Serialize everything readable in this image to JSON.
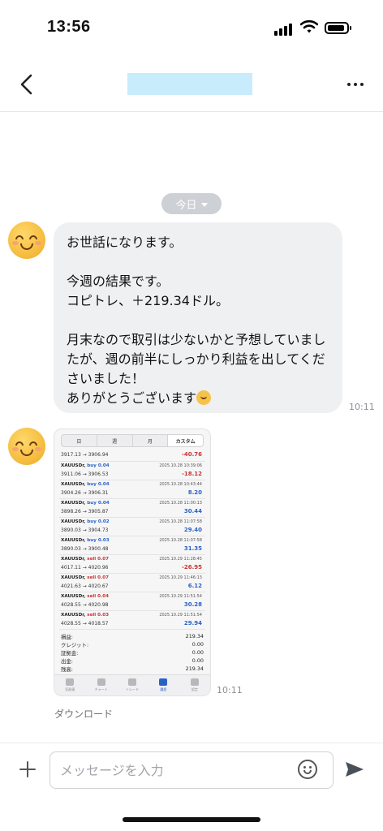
{
  "status_bar": {
    "time": "13:56"
  },
  "header": {
    "title_redacted": true,
    "title_block_color": "#c8ecfb"
  },
  "chat": {
    "date_chip": "今日",
    "text_message": {
      "lines": [
        "お世話になります。",
        "",
        "今週の結果です。",
        "コピトレ、＋219.34ドル。",
        "",
        "月末なので取引は少ないかと予想していましたが、週の前半にしっかり利益を出してくださいました！",
        "ありがとうございます"
      ],
      "time": "10:11"
    },
    "image_message": {
      "time": "10:11",
      "download_label": "ダウンロード",
      "tabs": [
        "日",
        "週",
        "月",
        "カスタム"
      ],
      "active_tab": "カスタム",
      "first_row": {
        "prices": "3917.13 → 3906.94",
        "pl": "-40.76",
        "pl_type": "neg"
      },
      "trades": [
        {
          "symbol": "XAUUSDr,",
          "side": "buy",
          "lot": "0.04",
          "prices": "3911.06 → 3906.53",
          "datetime": "2025.10.28 10:39:06",
          "pl": "-18.12",
          "pl_type": "neg"
        },
        {
          "symbol": "XAUUSDr,",
          "side": "buy",
          "lot": "0.04",
          "prices": "3904.26 → 3906.31",
          "datetime": "2025.10.28 10:43:44",
          "pl": "8.20",
          "pl_type": "pos"
        },
        {
          "symbol": "XAUUSDr,",
          "side": "buy",
          "lot": "0.04",
          "prices": "3898.26 → 3905.87",
          "datetime": "2025.10.28 11:00:13",
          "pl": "30.44",
          "pl_type": "pos"
        },
        {
          "symbol": "XAUUSDr,",
          "side": "buy",
          "lot": "0.02",
          "prices": "3890.03 → 3904.73",
          "datetime": "2025.10.28 11:07:58",
          "pl": "29.40",
          "pl_type": "pos"
        },
        {
          "symbol": "XAUUSDr,",
          "side": "buy",
          "lot": "0.03",
          "prices": "3890.03 → 3900.48",
          "datetime": "2025.10.28 11:07:58",
          "pl": "31.35",
          "pl_type": "pos"
        },
        {
          "symbol": "XAUUSDr,",
          "side": "sell",
          "lot": "0.07",
          "prices": "4017.11 → 4020.96",
          "datetime": "2025.10.29 11:28:45",
          "pl": "-26.95",
          "pl_type": "neg"
        },
        {
          "symbol": "XAUUSDr,",
          "side": "sell",
          "lot": "0.07",
          "prices": "4021.63 → 4020.67",
          "datetime": "2025.10.29 11:46:13",
          "pl": "6.12",
          "pl_type": "pos"
        },
        {
          "symbol": "XAUUSDr,",
          "side": "sell",
          "lot": "0.04",
          "prices": "4028.55 → 4020.98",
          "datetime": "2025.10.29 11:51:54",
          "pl": "30.28",
          "pl_type": "pos"
        },
        {
          "symbol": "XAUUSDr,",
          "side": "sell",
          "lot": "0.03",
          "prices": "4028.55 → 4018.57",
          "datetime": "2025.10.29 11:51:54",
          "pl": "29.94",
          "pl_type": "pos"
        }
      ],
      "summary": [
        {
          "label": "損益:",
          "value": "219.34"
        },
        {
          "label": "クレジット:",
          "value": "0.00"
        },
        {
          "label": "証拠金:",
          "value": "0.00"
        },
        {
          "label": "出金:",
          "value": "0.00"
        },
        {
          "label": "残高:",
          "value": "219.34"
        }
      ],
      "nav": [
        "気配値",
        "チャート",
        "トレード",
        "履歴",
        "設定"
      ],
      "active_nav": "履歴"
    }
  },
  "input": {
    "placeholder": "メッセージを入力"
  },
  "colors": {
    "buy": "#2a62c4",
    "sell": "#c8342f",
    "bubble": "#eef0f2",
    "date_chip": "#cdd0d4"
  }
}
